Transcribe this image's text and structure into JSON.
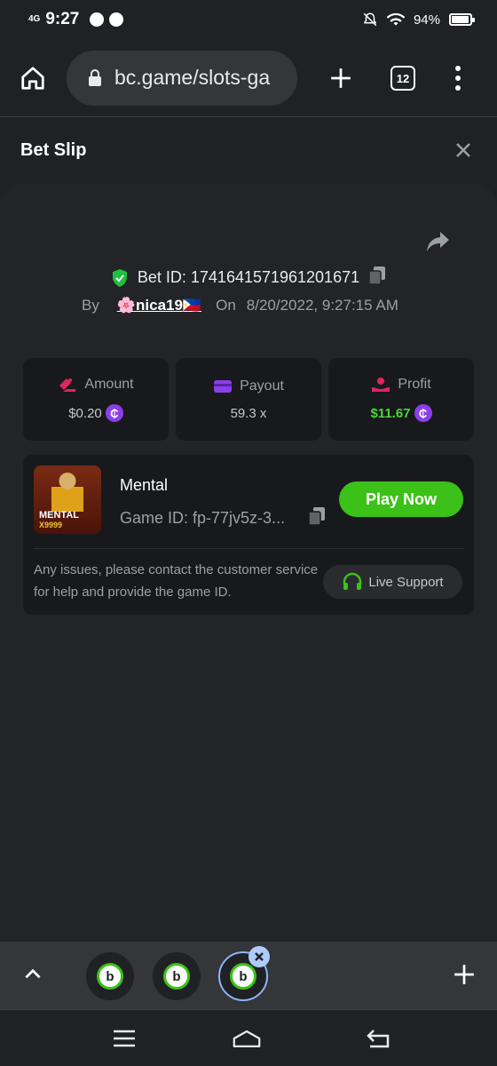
{
  "status_bar": {
    "network": "4G",
    "time": "9:27",
    "battery": "94%",
    "battery_level": 0.94
  },
  "browser": {
    "url": "bc.game/slots-ga",
    "tab_count": "12"
  },
  "bet_slip": {
    "title": "Bet Slip",
    "bet_id": "Bet ID: 1741641571961201671",
    "by_label": "By",
    "username": "🌸nica19🇵🇭",
    "on_label": "On",
    "datetime": "8/20/2022, 9:27:15 AM"
  },
  "stats": {
    "amount": {
      "label": "Amount",
      "value": "$0.20"
    },
    "payout": {
      "label": "Payout",
      "value": "59.3 x"
    },
    "profit": {
      "label": "Profit",
      "value": "$11.67"
    }
  },
  "game": {
    "name": "Mental",
    "game_id": "Game ID: fp-77jv5z-3...",
    "thumb_title": "MENTAL",
    "thumb_sub": "X9999",
    "play_label": "Play Now",
    "support_text": "Any issues, please contact the customer service for help and provide the game ID.",
    "live_support_label": "Live Support"
  },
  "colors": {
    "accent_green": "#3bc117",
    "profit_green": "#4ed33b",
    "coin_purple": "#8b3fe8",
    "verified_green": "#1fbf3f"
  },
  "tab_strip": {
    "tabs": [
      "bc-game-logo",
      "bc-game-logo",
      "bc-game-logo"
    ]
  }
}
